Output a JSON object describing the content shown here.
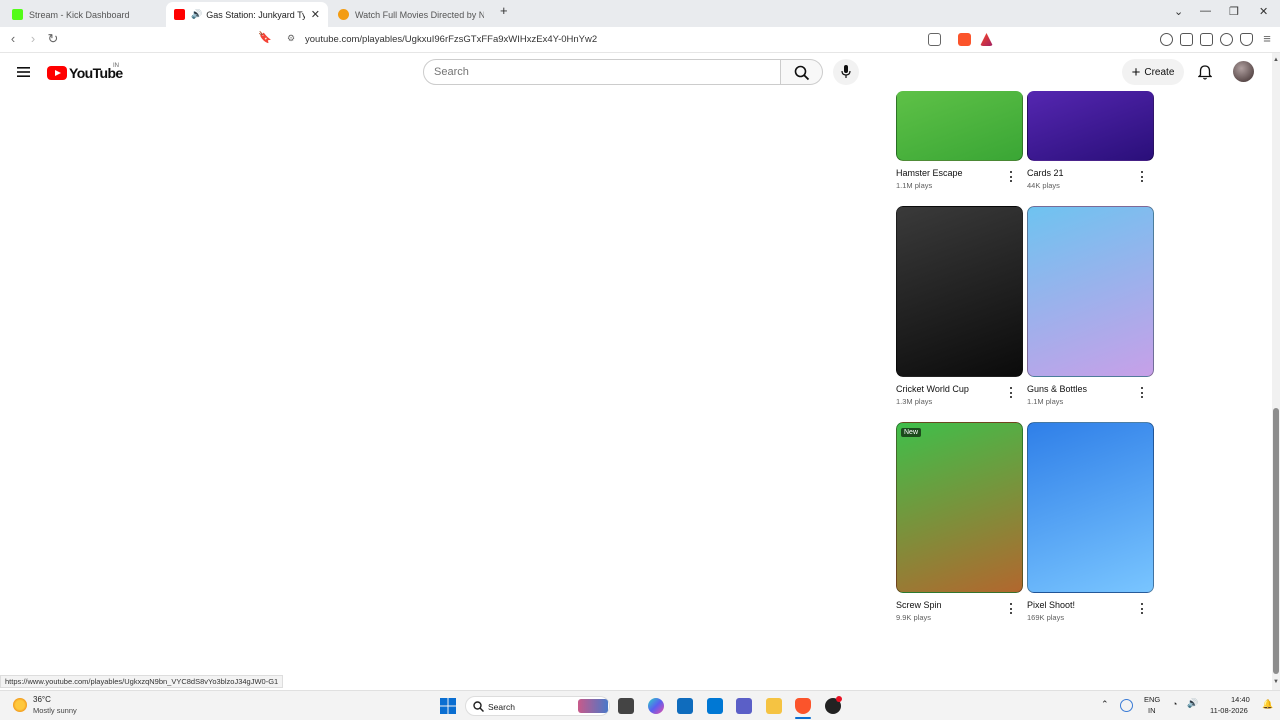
{
  "browser": {
    "tabs": [
      {
        "title": "Stream - Kick Dashboard",
        "favicon_color": "#53fc18",
        "active": false
      },
      {
        "title": "Gas Station: Junkyard Tycoon",
        "favicon_color": "#ff0000",
        "active": true
      },
      {
        "title": "Watch Full Movies Directed by Netfli",
        "favicon_color": "#f39c12",
        "active": false
      }
    ],
    "close_glyph": "✕",
    "new_tab_glyph": "+",
    "url": "youtube.com/playables/UgkxuI96rFzsGTxFFa9xWIHxzEx4Y-0HnYw2",
    "status_url": "https://www.youtube.com/playables/UgkxzqN9bn_VYC8dS8vYo3blzoJ34gJW0-G1"
  },
  "youtube": {
    "logo_text": "YouTube",
    "country_code": "IN",
    "search_placeholder": "Search",
    "create_label": "Create"
  },
  "games": [
    {
      "name": "Hamster Escape",
      "plays": "1.1M plays",
      "badge": "",
      "colors": [
        "#7ed957",
        "#3aa635"
      ]
    },
    {
      "name": "Cards 21",
      "plays": "44K plays",
      "badge": "",
      "colors": [
        "#7a3be0",
        "#2a0f7a"
      ]
    },
    {
      "name": "Cricket World Cup",
      "plays": "1.3M plays",
      "badge": "",
      "colors": [
        "#3a3a3a",
        "#0b0b0b"
      ]
    },
    {
      "name": "Guns & Bottles",
      "plays": "1.1M plays",
      "badge": "",
      "colors": [
        "#6ec3f0",
        "#c7a0e8"
      ]
    },
    {
      "name": "Screw Spin",
      "plays": "9.9K plays",
      "badge": "New",
      "colors": [
        "#3fbf4a",
        "#b2672e"
      ]
    },
    {
      "name": "Pixel Shoot!",
      "plays": "169K plays",
      "badge": "",
      "colors": [
        "#2f7fe8",
        "#79c5ff"
      ]
    }
  ],
  "taskbar": {
    "weather_temp": "36°C",
    "weather_desc": "Mostly sunny",
    "search_label": "Search",
    "lang_top": "ENG",
    "lang_bottom": "IN",
    "time": "14:40",
    "date": "11-08-2026"
  }
}
